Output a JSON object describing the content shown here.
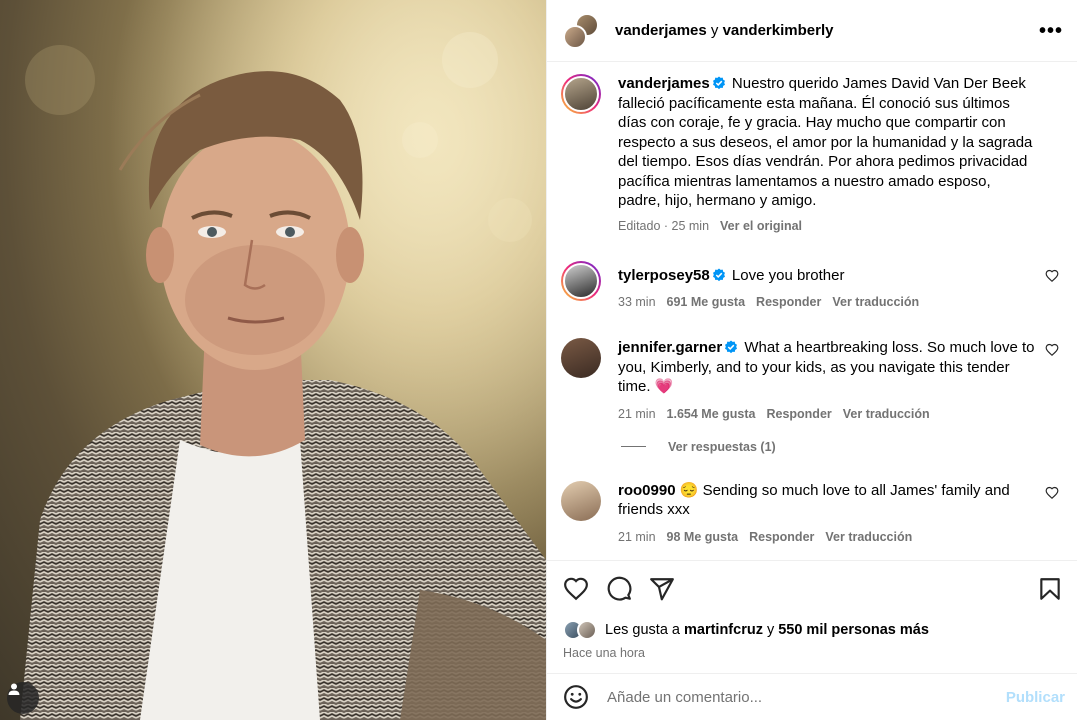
{
  "header": {
    "user1": "vanderjames",
    "conjunction": "y",
    "user2": "vanderkimberly",
    "more_label": "•••"
  },
  "caption": {
    "username": "vanderjames",
    "text": "Nuestro querido James David Van Der Beek falleció pacíficamente esta mañana. Él conoció sus últimos días con coraje, fe y gracia. Hay mucho que compartir con respecto a sus deseos, el amor por la humanidad y la sagrada del tiempo. Esos días vendrán. Por ahora pedimos privacidad pacífica mientras lamentamos a nuestro amado esposo, padre, hijo, hermano y amigo.",
    "edited": "Editado · 25 min",
    "see_original": "Ver el original"
  },
  "comments": [
    {
      "username": "tylerposey58",
      "text": "Love you brother",
      "time": "33 min",
      "likes": "691 Me gusta",
      "reply": "Responder",
      "translate": "Ver traducción"
    },
    {
      "username": "jennifer.garner",
      "text": "What a heartbreaking loss. So much love to you, Kimberly, and to your kids, as you navigate this tender time. 💗",
      "time": "21 min",
      "likes": "1.654 Me gusta",
      "reply": "Responder",
      "translate": "Ver traducción",
      "view_replies": "Ver respuestas (1)"
    },
    {
      "username": "roo0990",
      "text": "😔 Sending so much love to all James' family and friends xxx",
      "time": "21 min",
      "likes": "98 Me gusta",
      "reply": "Responder",
      "translate": "Ver traducción"
    }
  ],
  "likes": {
    "prefix": "Les gusta a",
    "user": "martinfcruz",
    "joiner": "y",
    "count": "550 mil personas más"
  },
  "time_ago": "Hace una hora",
  "comment_box": {
    "placeholder": "Añade un comentario...",
    "publish_label": "Publicar"
  },
  "colors": {
    "verified": "#0095f6",
    "publish_disabled": "#b2dffc",
    "secondary_text": "#737373"
  },
  "icons": [
    "heart-icon",
    "comment-icon",
    "share-icon",
    "bookmark-icon",
    "emoji-icon",
    "user-tag-icon",
    "more-icon",
    "verified-badge-icon"
  ]
}
